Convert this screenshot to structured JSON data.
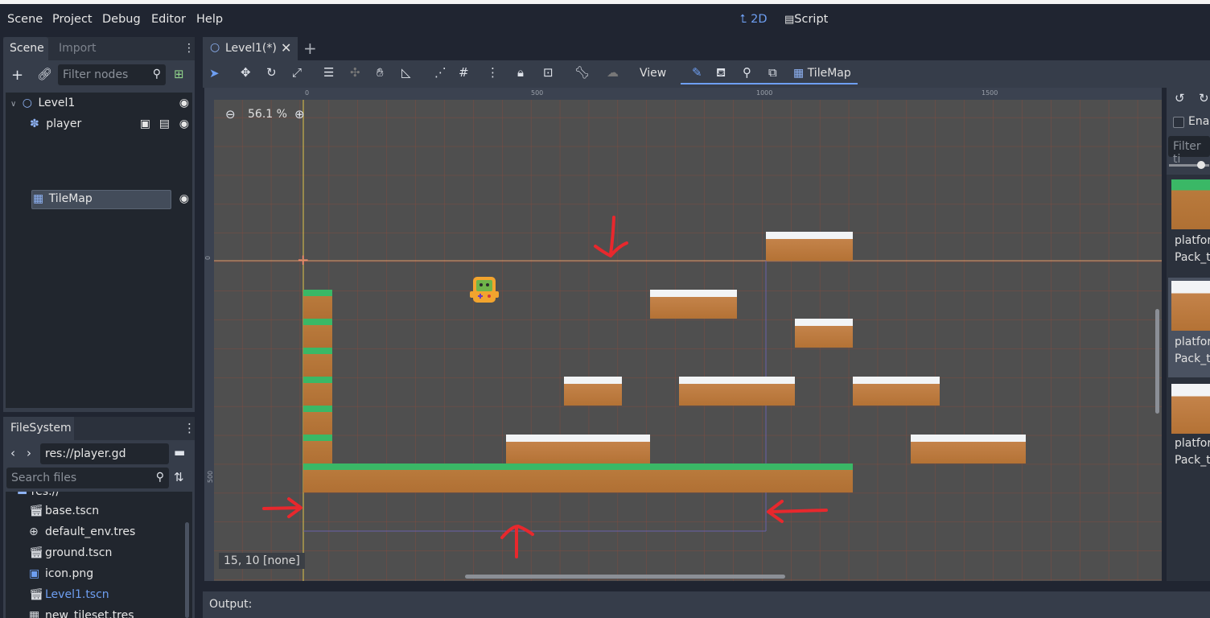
{
  "menu": {
    "items": [
      "Scene",
      "Project",
      "Debug",
      "Editor",
      "Help"
    ],
    "mode_2d": "2D",
    "mode_script": "Script"
  },
  "scene_dock": {
    "tab_scene": "Scene",
    "tab_import": "Import",
    "filter_placeholder": "Filter nodes",
    "nodes": [
      {
        "label": "Level1",
        "icon": "node2d-icon"
      },
      {
        "label": "player",
        "icon": "kinematic-body-icon"
      },
      {
        "label": "TileMap",
        "icon": "tilemap-icon"
      }
    ]
  },
  "filesystem": {
    "tab": "FileSystem",
    "path": "res://player.gd",
    "search_placeholder": "Search files",
    "root": "res://",
    "files": [
      {
        "name": "base.tscn",
        "icon": "scene-icon"
      },
      {
        "name": "default_env.tres",
        "icon": "globe-icon"
      },
      {
        "name": "ground.tscn",
        "icon": "scene-icon"
      },
      {
        "name": "icon.png",
        "icon": "image-icon"
      },
      {
        "name": "Level1.tscn",
        "icon": "scene-icon"
      },
      {
        "name": "new_tileset.tres",
        "icon": "resource-icon"
      }
    ]
  },
  "editor": {
    "tab_label": "Level1(*)",
    "view_menu": "View",
    "tilemap_button": "TileMap",
    "zoom": "56.1 %",
    "ruler_marks": {
      "h": [
        "0",
        "500",
        "1000",
        "1500"
      ],
      "v": [
        "0",
        "500"
      ]
    },
    "status": "15, 10 [none]"
  },
  "tile_palette": {
    "enable_label": "Enab",
    "filter_placeholder": "Filter ti",
    "items": [
      {
        "line1": "platfor",
        "line2": "Pack_ti"
      },
      {
        "line1": "platfor",
        "line2": "Pack_ti"
      },
      {
        "line1": "platfor",
        "line2": "Pack_ti"
      }
    ]
  },
  "output": {
    "label": "Output:"
  },
  "colors": {
    "accent": "#6e9ff2",
    "panel": "#363d4a",
    "background": "#202531",
    "annotation_red": "#e8282d",
    "grass": "#3ab866",
    "dirt": "#b47235"
  }
}
